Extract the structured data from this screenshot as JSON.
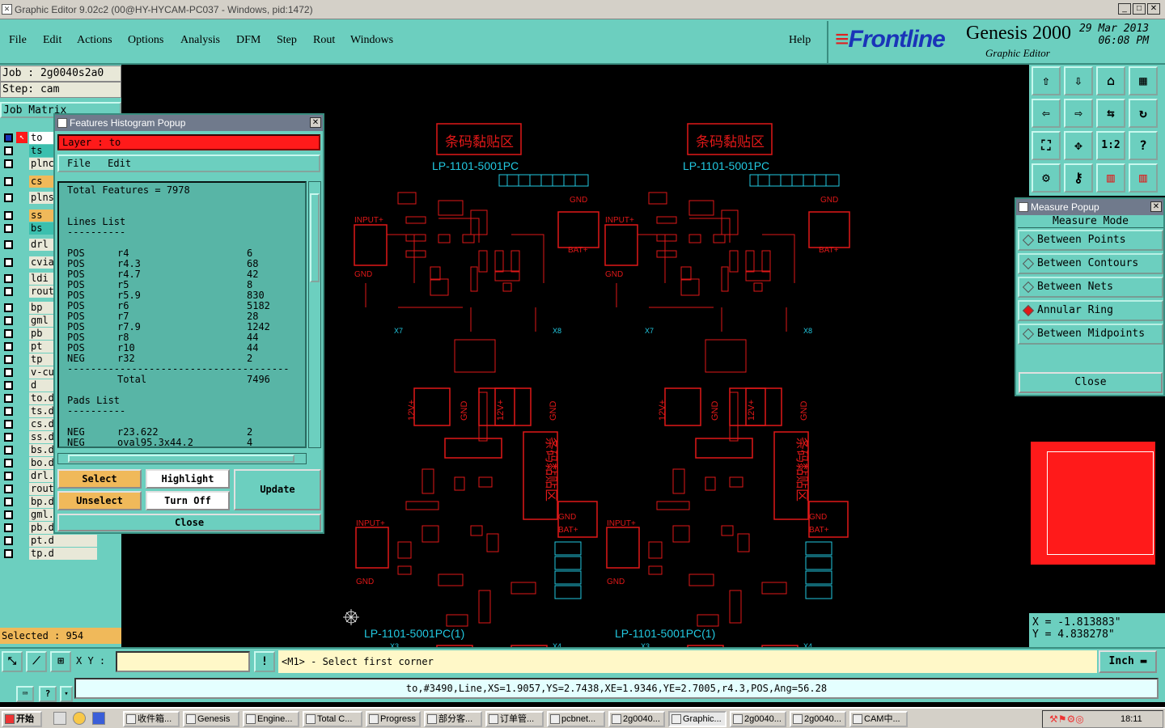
{
  "window": {
    "title": "Graphic Editor 9.02c2 (00@HY-HYCAM-PC037 - Windows, pid:1472)"
  },
  "menu": {
    "items": [
      "File",
      "Edit",
      "Actions",
      "Options",
      "Analysis",
      "DFM",
      "Step",
      "Rout",
      "Windows"
    ],
    "help": "Help"
  },
  "brand": {
    "logo": "Frontline",
    "product": "Genesis 2000",
    "subtitle": "Graphic Editor",
    "date": "29 Mar 2013",
    "time": "06:08 PM"
  },
  "job": {
    "job_label": "Job : 2g0040s2a0",
    "step_label": "Step: cam",
    "matrix_label": "Job Matrix"
  },
  "layers": [
    "to",
    "ts",
    "plnc",
    "cs",
    "plns",
    "ss",
    "bs",
    "drl",
    "cvia",
    "ldi",
    "rout",
    "bp",
    "gml",
    "pb",
    "pt",
    "tp",
    "v-cu",
    "d",
    "to.d",
    "ts.d",
    "cs.d",
    "ss.d",
    "bs.d",
    "bo.d",
    "drl.d",
    "rout",
    "bp.d",
    "gml.d",
    "pb.d",
    "pt.d",
    "tp.d"
  ],
  "selected_text": "Selected : 954",
  "histogram": {
    "title": "Features Histogram Popup",
    "layer_label": "Layer :",
    "layer_value": "to",
    "menu_file": "File",
    "menu_edit": "Edit",
    "total_features": "Total Features = 7978",
    "lines_header": "Lines List",
    "underline": "----------",
    "rows": [
      [
        "POS",
        "r4",
        "6"
      ],
      [
        "POS",
        "r4.3",
        "68"
      ],
      [
        "POS",
        "r4.7",
        "42"
      ],
      [
        "POS",
        "r5",
        "8"
      ],
      [
        "POS",
        "r5.9",
        "830"
      ],
      [
        "POS",
        "r6",
        "5182"
      ],
      [
        "POS",
        "r7",
        "28"
      ],
      [
        "POS",
        "r7.9",
        "1242"
      ],
      [
        "POS",
        "r8",
        "44"
      ],
      [
        "POS",
        "r10",
        "44"
      ],
      [
        "NEG",
        "r32",
        "2"
      ]
    ],
    "divider": "--------------------------------------",
    "total_label": "Total",
    "total_value": "7496",
    "pads_header": "Pads List",
    "pads_rows": [
      [
        "NEG",
        "r23.622",
        "2"
      ],
      [
        "NEG",
        "oval95.3x44.2",
        "4"
      ]
    ],
    "buttons": {
      "select": "Select",
      "highlight": "Highlight",
      "update": "Update",
      "unselect": "Unselect",
      "turn_off": "Turn Off",
      "close": "Close"
    }
  },
  "measure": {
    "title": "Measure Popup",
    "mode_label": "Measure Mode",
    "options": [
      "Between Points",
      "Between Contours",
      "Between Nets",
      "Annular Ring",
      "Between Midpoints"
    ],
    "active_option": "Annular Ring",
    "close": "Close"
  },
  "coords": {
    "x": "X = -1.813883\"",
    "y": "Y = 4.838278\""
  },
  "command": {
    "xy_label": "X Y :",
    "prompt": "<M1> - Select first corner",
    "units": "Inch"
  },
  "status": {
    "text": "to,#3490,Line,XS=1.9057,YS=2.7438,XE=1.9346,YE=2.7005,r4.3,POS,Ang=56.28"
  },
  "board": {
    "title_left": "LP-1101-5001PC",
    "title_bottom": "LP-1101-5001PC(1)",
    "barcode_label": "条码黏贴区",
    "labels": [
      "GND",
      "BAT+",
      "INPUT+",
      "12V+",
      "X1",
      "X2",
      "X3",
      "X4",
      "X7",
      "X8"
    ]
  },
  "taskbar": {
    "start": "开始",
    "tasks": [
      "收件箱...",
      "Genesis",
      "Engine...",
      "Total C...",
      "Progress",
      "部分客...",
      "订单管...",
      "pcbnet...",
      "2g0040...",
      "Graphic...",
      "2g0040...",
      "2g0040...",
      "CAM中..."
    ],
    "clock": "18:11"
  },
  "colors": {
    "panel": "#6ccfbf",
    "trace": "#e01818",
    "silk": "#22c8e0",
    "layer_red": "#ff1a1a",
    "selected": "#f0b95a"
  }
}
